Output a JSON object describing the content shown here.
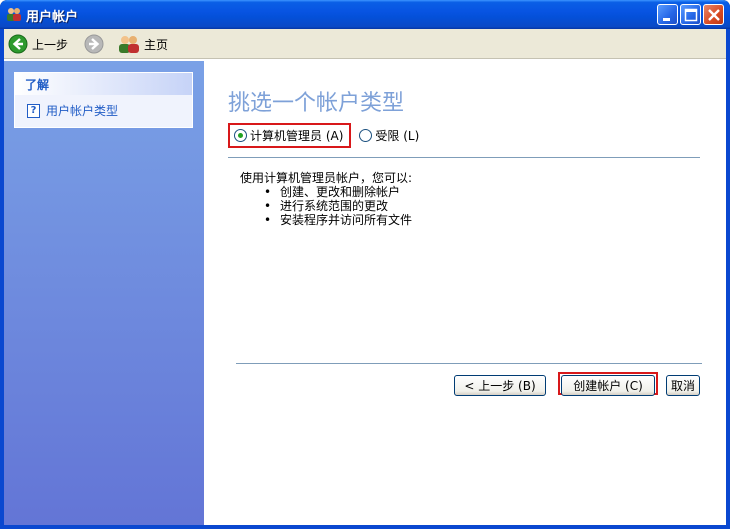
{
  "window": {
    "title": "用户帐户"
  },
  "toolbar": {
    "back_label": "上一步",
    "home_label": "主页"
  },
  "sidebar": {
    "header": "了解",
    "items": [
      {
        "label": "用户帐户类型"
      }
    ]
  },
  "main": {
    "heading": "挑选一个帐户类型",
    "options": [
      {
        "label": "计算机管理员 (A)",
        "selected": true
      },
      {
        "label": "受限 (L)",
        "selected": false
      }
    ],
    "description": "使用计算机管理员帐户，您可以:",
    "bullets": [
      "创建、更改和删除帐户",
      "进行系统范围的更改",
      "安装程序并访问所有文件"
    ]
  },
  "buttons": {
    "back": "< 上一步 (B)",
    "create": "创建帐户 (C)",
    "cancel": "取消"
  },
  "colors": {
    "accent": "#215dc6",
    "highlight": "#d8181a",
    "heading": "#7ea1d8"
  }
}
